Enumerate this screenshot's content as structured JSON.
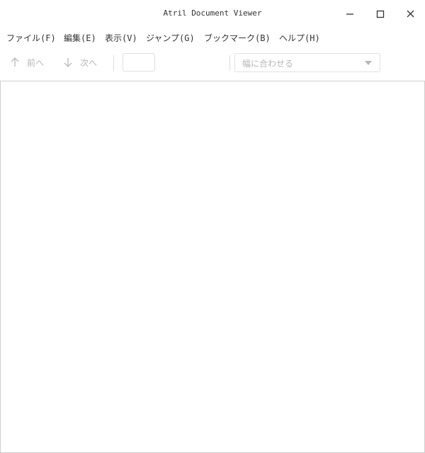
{
  "window": {
    "title": "Atril Document Viewer"
  },
  "menubar": {
    "items": [
      {
        "label": "ファイル(F)"
      },
      {
        "label": "編集(E)"
      },
      {
        "label": "表示(V)"
      },
      {
        "label": "ジャンプ(G)"
      },
      {
        "label": "ブックマーク(B)"
      },
      {
        "label": "ヘルプ(H)"
      }
    ]
  },
  "toolbar": {
    "prev_label": "前へ",
    "next_label": "次へ",
    "page_value": "",
    "zoom_value": "幅に合わせる"
  },
  "colors": {
    "disabled_text": "#b7b7b7",
    "border": "#cfcfcf"
  },
  "icons": {
    "prev": "arrow-up-icon",
    "next": "arrow-down-icon",
    "dropdown": "chevron-down-icon"
  }
}
